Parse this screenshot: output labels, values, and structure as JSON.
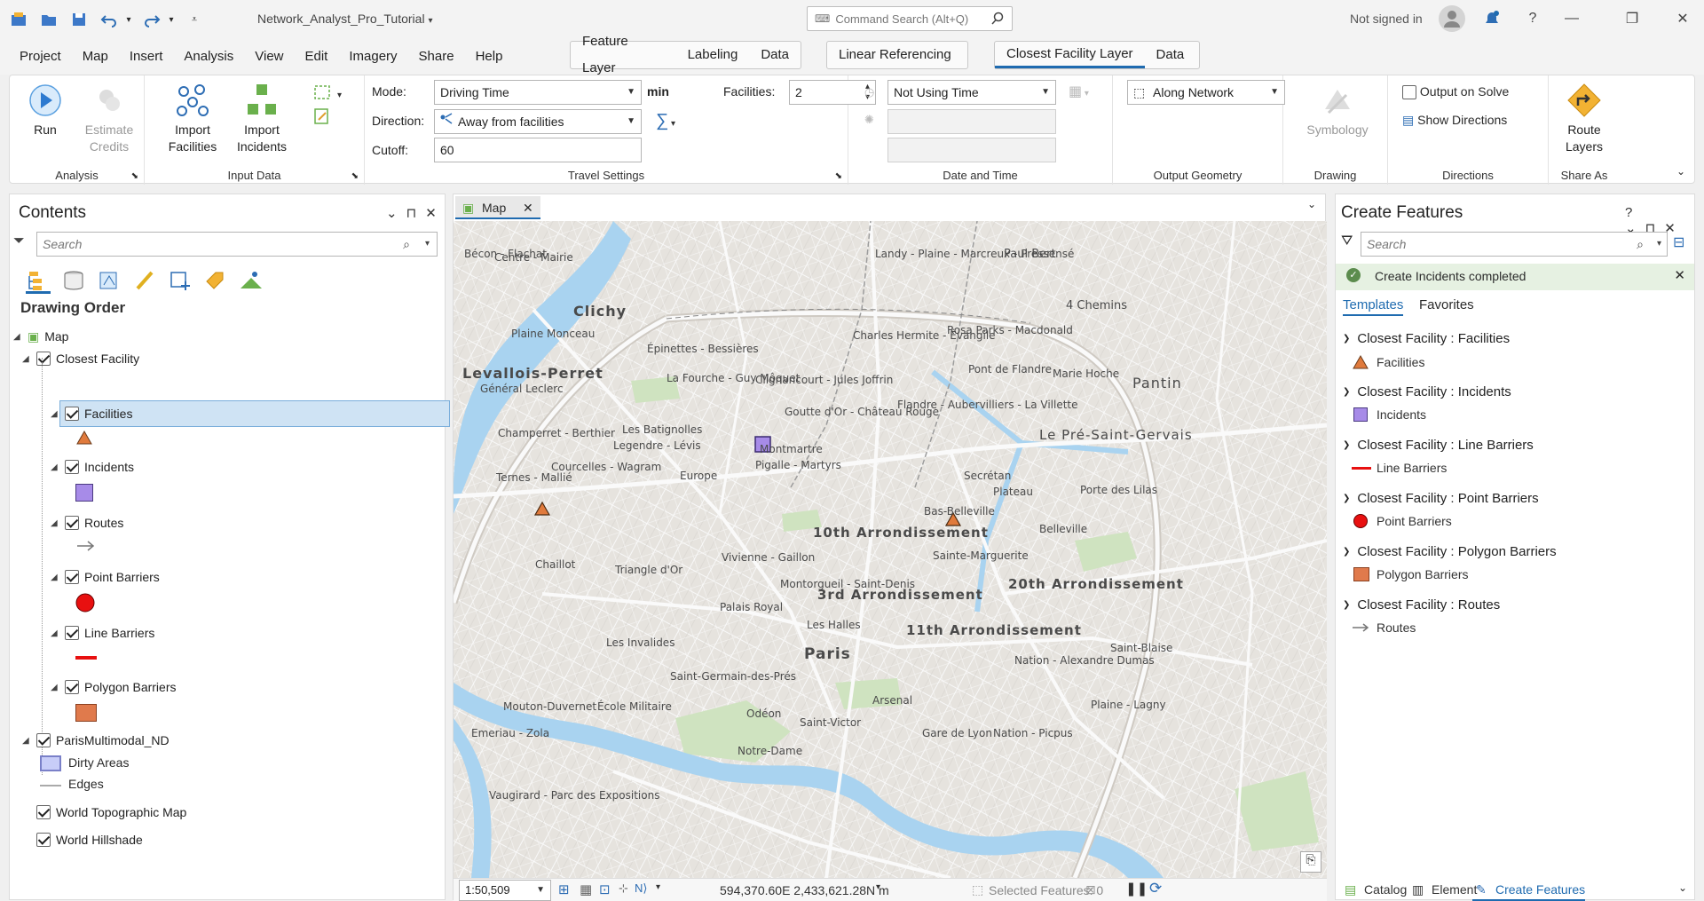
{
  "app": {
    "project_title": "Network_Analyst_Pro_Tutorial",
    "command_search_placeholder": "Command Search (Alt+Q)",
    "signin": "Not signed in"
  },
  "menu": [
    "Project",
    "Map",
    "Insert",
    "Analysis",
    "View",
    "Edit",
    "Imagery",
    "Share",
    "Help"
  ],
  "context_tabs": {
    "group1": [
      "Feature Layer",
      "Labeling",
      "Data"
    ],
    "group2": [
      "Linear Referencing"
    ],
    "group3": [
      "Closest Facility Layer",
      "Data"
    ]
  },
  "ribbon": {
    "analysis": {
      "label": "Analysis",
      "run": "Run",
      "estimate": "Estimate Credits"
    },
    "input_data": {
      "label": "Input Data",
      "import_facilities": "Import Facilities",
      "import_incidents": "Import Incidents"
    },
    "travel": {
      "label": "Travel Settings",
      "mode_label": "Mode:",
      "mode_value": "Driving Time",
      "unit": "min",
      "facilities_label": "Facilities:",
      "facilities_value": "2",
      "direction_label": "Direction:",
      "direction_value": "Away from facilities",
      "cutoff_label": "Cutoff:",
      "cutoff_value": "60"
    },
    "datetime": {
      "label": "Date and Time",
      "time_value": "Not Using Time"
    },
    "output": {
      "label": "Output Geometry",
      "value": "Along Network"
    },
    "drawing": {
      "label": "Drawing",
      "symbology": "Symbology"
    },
    "directions": {
      "label": "Directions",
      "output_on_solve": "Output on Solve",
      "show_directions": "Show Directions"
    },
    "share": {
      "label": "Share As",
      "route_layers": "Route Layers"
    }
  },
  "contents": {
    "title": "Contents",
    "search_placeholder": "Search",
    "drawing_order": "Drawing Order",
    "map": "Map",
    "closest_facility": "Closest Facility",
    "layers": [
      "Facilities",
      "Incidents",
      "Routes",
      "Point Barriers",
      "Line Barriers",
      "Polygon Barriers"
    ],
    "network": "ParisMultimodal_ND",
    "dirty_areas": "Dirty Areas",
    "edges": "Edges",
    "basemaps": [
      "World Topographic Map",
      "World Hillshade"
    ]
  },
  "map": {
    "tab": "Map",
    "scale": "1:50,509",
    "coords": "594,370.60E 2,433,621.28N m",
    "selected": "Selected Features: 0",
    "labels": [
      "Clichy",
      "Levallois-Perret",
      "Pantin",
      "Le Pré-Saint-Gervais",
      "10th Arrondissement",
      "3rd Arrondissement",
      "11th Arrondissement",
      "20th Arrondissement",
      "Paris",
      "Paul Bert",
      "4 Chemins",
      "Marie Hoche",
      "Landy - Plaine - Marcreux - Pressensé",
      "Bécon - Flachat",
      "Centre - Mairie",
      "Général Leclerc",
      "Épinettes - Bessières",
      "Les Batignolles",
      "Montmartre",
      "Europe",
      "Ternes - Mallié",
      "Courcelles - Wagram",
      "Triangle d'Or",
      "Chaillot",
      "Palais Royal",
      "Les Invalides",
      "École Militaire",
      "Saint-Germain-des-Prés",
      "Arsenal",
      "Odéon",
      "Saint-Victor",
      "Notre-Dame",
      "Nation - Alexandre Dumas",
      "Saint-Blaise",
      "Belleville",
      "Secrétan",
      "Flandre - Aubervilliers - La Villette",
      "Bas-Belleville",
      "Plateau",
      "Porte des Lilas",
      "Sainte-Marguerite",
      "Emeriau - Zola",
      "Mouton-Duvernet",
      "Vivienne - Gaillon",
      "Montorgueil - Saint-Denis",
      "Les Halles",
      "Plaine - Lagny",
      "Nation - Picpus",
      "Gare de Lyon",
      "Vaugirard - Parc des Expositions",
      "Charles Hermite - Évangile",
      "Rosa Parks - Macdonald",
      "Pont de Flandre",
      "Goutte d'Or - Château Rouge",
      "Clignancourt - Jules Joffrin",
      "La Fourche - Guy Môquet",
      "Champerret - Berthier",
      "Plaine Monceau",
      "Pigalle - Martyrs",
      "Legendre - Lévis"
    ]
  },
  "create": {
    "title": "Create Features",
    "search_placeholder": "Search",
    "message": "Create Incidents completed",
    "tabs": [
      "Templates",
      "Favorites"
    ],
    "groups": [
      {
        "title": "Closest Facility : Facilities",
        "item": "Facilities"
      },
      {
        "title": "Closest Facility : Incidents",
        "item": "Incidents"
      },
      {
        "title": "Closest Facility : Line Barriers",
        "item": "Line Barriers"
      },
      {
        "title": "Closest Facility : Point Barriers",
        "item": "Point Barriers"
      },
      {
        "title": "Closest Facility : Polygon Barriers",
        "item": "Polygon Barriers"
      },
      {
        "title": "Closest Facility : Routes",
        "item": "Routes"
      }
    ],
    "bottom_tabs": [
      "Catalog",
      "Element",
      "Create Features"
    ]
  },
  "colors": {
    "accent": "#1f6bb0",
    "facility": "#e07a3c",
    "incident": "#a78be8",
    "barrier": "#e81010",
    "polygon": "#e07a4c",
    "water": "#a9d3f0",
    "park": "#cfe3c0"
  }
}
